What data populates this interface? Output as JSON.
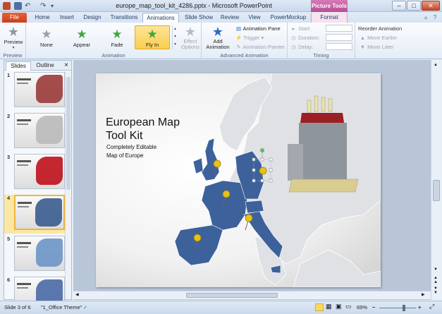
{
  "window": {
    "title": "europe_map_tool_kit_4286.pptx - Microsoft PowerPoint",
    "context_tab_header": "Picture Tools"
  },
  "tabs": [
    "File",
    "Home",
    "Insert",
    "Design",
    "Transitions",
    "Animations",
    "Slide Show",
    "Review",
    "View",
    "PowerMockup",
    "Format"
  ],
  "ribbon": {
    "preview": {
      "label": "Preview",
      "group": "Preview"
    },
    "animation_gallery": [
      {
        "label": "None",
        "icon": "star-gray-icon",
        "selected": false
      },
      {
        "label": "Appear",
        "icon": "star-green-icon",
        "selected": false
      },
      {
        "label": "Fade",
        "icon": "star-green-icon",
        "selected": false
      },
      {
        "label": "Fly In",
        "icon": "star-green-icon",
        "selected": true
      }
    ],
    "effect_options_label": "Effect Options",
    "animation_group_label": "Animation",
    "add_animation_label": "Add Animation",
    "animation_pane_label": "Animation Pane",
    "trigger_label": "Trigger",
    "animation_painter_label": "Animation Painter",
    "advanced_group_label": "Advanced Animation",
    "start_label": "Start:",
    "duration_label": "Duration:",
    "delay_label": "Delay:",
    "timing_group_label": "Timing",
    "reorder_title": "Reorder Animation",
    "move_earlier_label": "Move Earlier",
    "move_later_label": "Move Later"
  },
  "left_pane": {
    "tabs": [
      "Slides",
      "Outline"
    ],
    "close_glyph": "×",
    "thumbnails": [
      {
        "num": "1",
        "theme": "#9b3a3a",
        "selected": false
      },
      {
        "num": "2",
        "theme": "#b9b9b9",
        "selected": false
      },
      {
        "num": "3",
        "theme": "#c0111b",
        "selected": false
      },
      {
        "num": "4",
        "theme": "#3b5c8f",
        "selected": true
      },
      {
        "num": "5",
        "theme": "#6d95c8",
        "selected": false
      },
      {
        "num": "6",
        "theme": "#4a6aa6",
        "selected": false
      }
    ]
  },
  "slide": {
    "title_line1": "European Map",
    "title_line2": "Tool Kit",
    "subtitle_line1": "Completely Editable",
    "subtitle_line2": "Map of Europe",
    "highlight_color": "#3d619b",
    "map_color": "#dfe1e5"
  },
  "status_bar": {
    "slide_info": "Slide 3 of 6",
    "theme": "\"1_Office Theme\"",
    "zoom": "69%",
    "zoom_level_fraction": 0.69
  }
}
